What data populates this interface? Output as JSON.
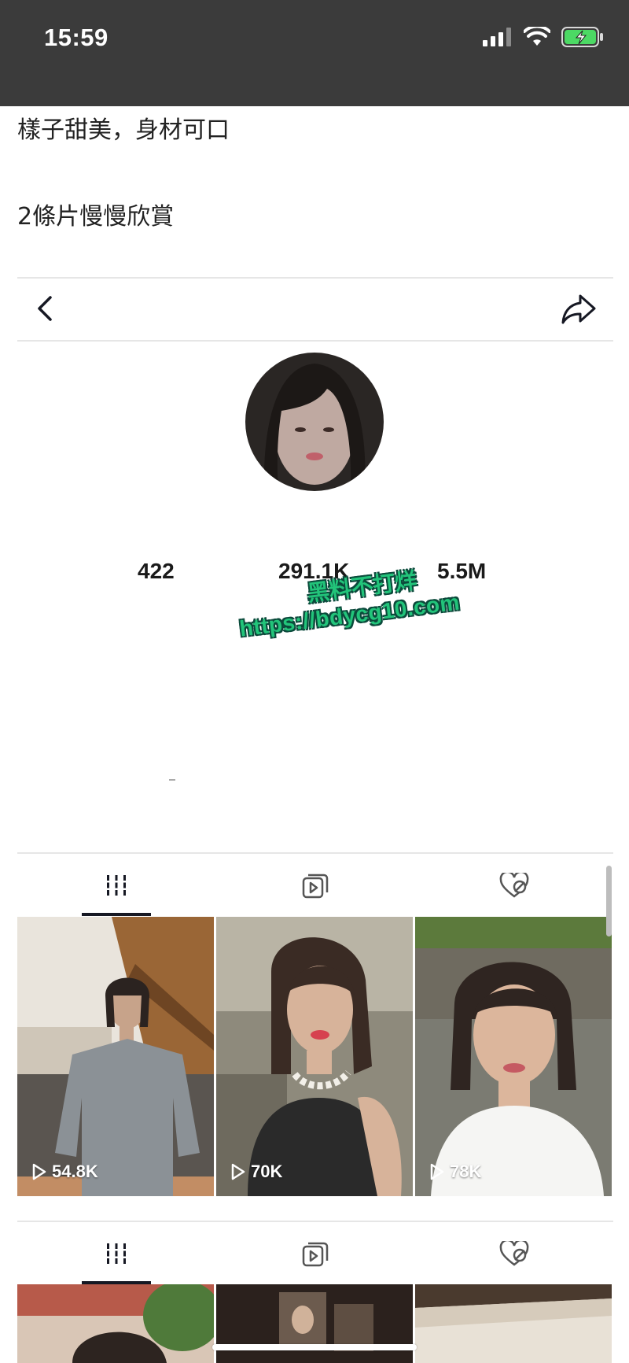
{
  "status_bar": {
    "time": "15:59"
  },
  "post": {
    "caption_line1": "樣子甜美，身材可口",
    "caption_line2": "2條片慢慢欣賞"
  },
  "profile": {
    "stats": {
      "following": "422",
      "followers": "291.1K",
      "likes": "5.5M"
    }
  },
  "watermark": {
    "line1": "黑料不打烊",
    "line2": "https://bdycg10.com"
  },
  "tabs": [
    {
      "icon": "grid-icon",
      "active": true
    },
    {
      "icon": "repost-icon",
      "active": false
    },
    {
      "icon": "liked-hidden-icon",
      "active": false
    }
  ],
  "videos": [
    {
      "views": "54.8K"
    },
    {
      "views": "70K"
    },
    {
      "views": "78K"
    }
  ],
  "colors": {
    "status_bar": "#3b3b3b",
    "watermark": "#22c47a",
    "battery": "#4cd964"
  }
}
